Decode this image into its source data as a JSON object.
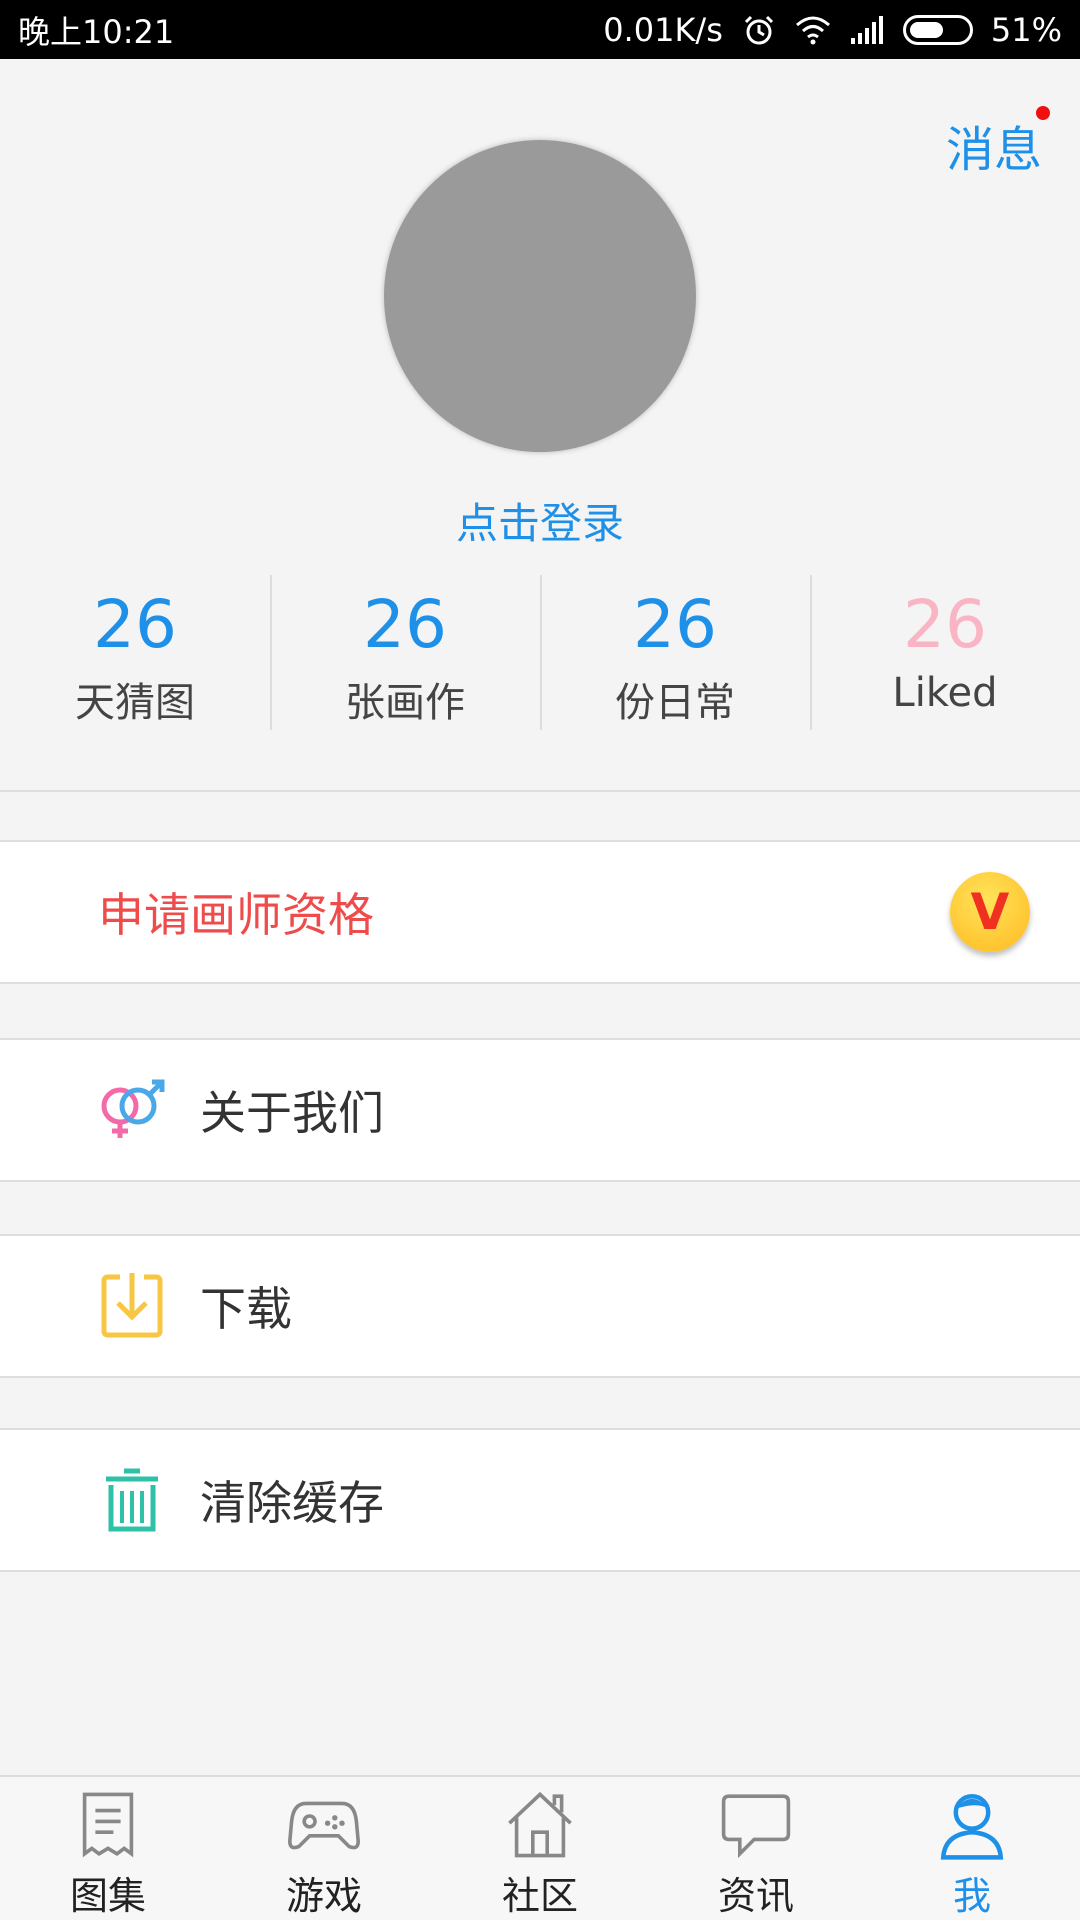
{
  "status_bar": {
    "time": "晚上10:21",
    "speed": "0.01K/s",
    "battery": "51%",
    "battery_level": 0.51
  },
  "header": {
    "messages_label": "消息",
    "has_unread": true
  },
  "profile": {
    "login_label": "点击登录"
  },
  "stats": [
    {
      "value": "26",
      "label": "天猜图"
    },
    {
      "value": "26",
      "label": "张画作"
    },
    {
      "value": "26",
      "label": "份日常"
    },
    {
      "value": "26",
      "label": "Liked"
    }
  ],
  "menu": {
    "apply": {
      "label": "申请画师资格",
      "badge": "V"
    },
    "about": {
      "label": "关于我们"
    },
    "download": {
      "label": "下载"
    },
    "clear_cache": {
      "label": "清除缓存"
    }
  },
  "bottom_nav": [
    {
      "label": "图集",
      "icon": "album-icon"
    },
    {
      "label": "游戏",
      "icon": "gamepad-icon"
    },
    {
      "label": "社区",
      "icon": "home-icon"
    },
    {
      "label": "资讯",
      "icon": "chat-bubble-icon"
    },
    {
      "label": "我",
      "icon": "user-icon",
      "active": true
    }
  ],
  "colors": {
    "accent": "#1e90e8",
    "apply_red": "#ef4b4b",
    "liked_pink": "#f9b5c3"
  }
}
